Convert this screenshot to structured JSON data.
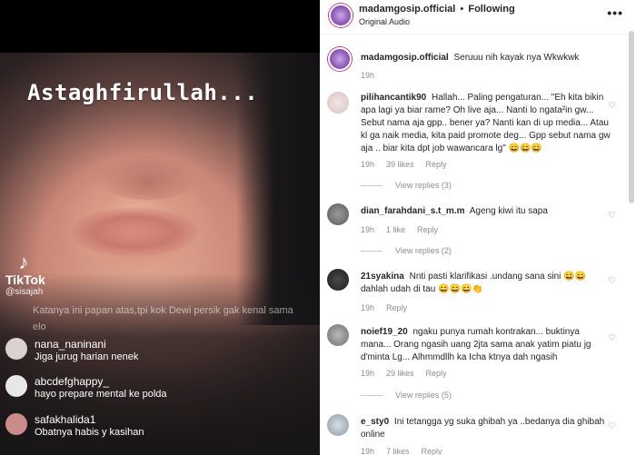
{
  "video": {
    "overlay_title": "Astaghfirullah...",
    "tiktok_brand": "TikTok",
    "tiktok_handle": "@sisajah",
    "faded_comment": "Katanya ini papan atas,tpi kok Dewi persik gak kenal sama elo",
    "live_comments": [
      {
        "user": "nana_naninani",
        "text": "Jiga jurug harian nenek"
      },
      {
        "user": "abcdefghappy_",
        "text": "hayo prepare mental ke polda"
      },
      {
        "user": "safakhalida1",
        "text": "Obatnya habis y kasihan"
      }
    ]
  },
  "header": {
    "username": "madamgosip.official",
    "separator": "•",
    "follow_status": "Following",
    "audio": "Original Audio",
    "more_icon": "more-options-icon"
  },
  "caption": {
    "user": "madamgosip.official",
    "text": "Seruuu nih kayak nya Wkwkwk",
    "time": "19h"
  },
  "comments": [
    {
      "user": "pilihancantik90",
      "text": "Hallah... Paling pengaturan... \"Eh kita bikin apa lagi ya biar rame? Oh live aja... Nanti lo ngata²in gw... Sebut nama aja gpp.. bener ya? Nanti kan di up media... Atau kl ga naik media, kita paid promote deg... Gpp sebut nama gw aja .. biar kita dpt job wawancara lg\" 😄😄😄",
      "time": "19h",
      "likes": "39 likes",
      "reply": "Reply",
      "view_replies": "View replies (3)"
    },
    {
      "user": "dian_farahdani_s.t_m.m",
      "text": "Ageng kiwi itu sapa",
      "time": "19h",
      "likes": "1 like",
      "reply": "Reply",
      "view_replies": "View replies (2)"
    },
    {
      "user": "21syakina",
      "text": "Nnti pasti klarifikasi .undang sana sini 😄😄 dahlah udah di tau 😄😄😄👏",
      "time": "19h",
      "likes": "",
      "reply": "Reply",
      "view_replies": ""
    },
    {
      "user": "noief19_20",
      "text": "ngaku punya rumah kontrakan... buktinya mana... Orang ngasih uang 2jta sama anak yatim piatu jg d'minta Lg... Alhmmdllh ka Icha ktnya dah ngasih",
      "time": "19h",
      "likes": "29 likes",
      "reply": "Reply",
      "view_replies": "View replies (5)"
    },
    {
      "user": "e_sty0",
      "text": "Ini tetangga yg suka ghibah ya ..bedanya dia ghibah online",
      "time": "19h",
      "likes": "7 likes",
      "reply": "Reply",
      "view_replies": ""
    }
  ]
}
